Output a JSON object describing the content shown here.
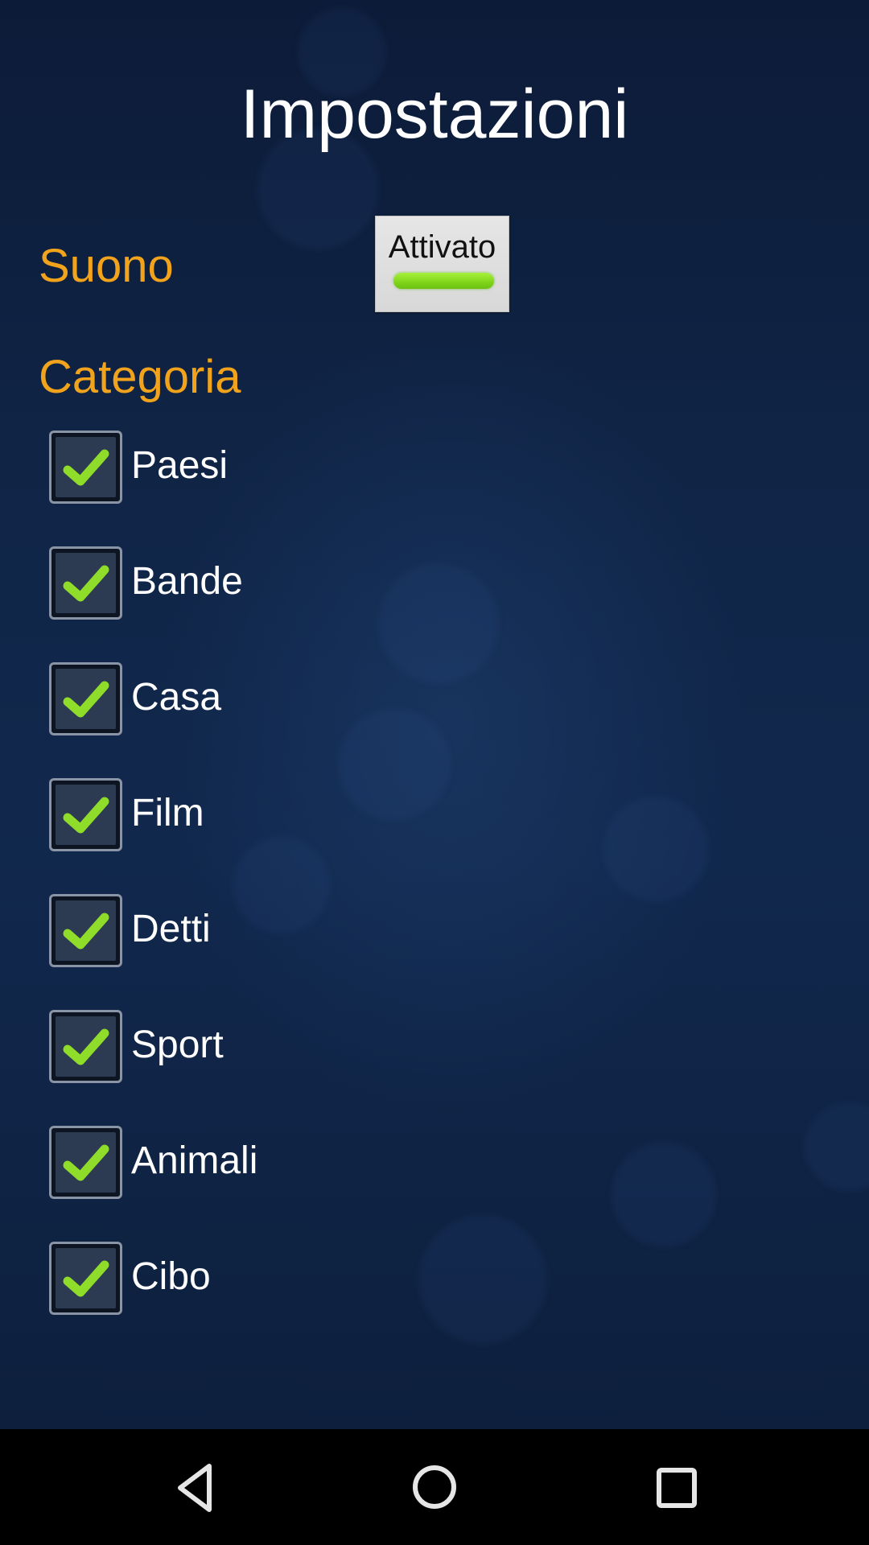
{
  "page": {
    "title": "Impostazioni"
  },
  "sound": {
    "label": "Suono",
    "toggle_label": "Attivato",
    "enabled": true
  },
  "category": {
    "label": "Categoria",
    "items": [
      {
        "label": "Paesi",
        "checked": true
      },
      {
        "label": "Bande",
        "checked": true
      },
      {
        "label": "Casa",
        "checked": true
      },
      {
        "label": "Film",
        "checked": true
      },
      {
        "label": "Detti",
        "checked": true
      },
      {
        "label": "Sport",
        "checked": true
      },
      {
        "label": "Animali",
        "checked": true
      },
      {
        "label": "Cibo",
        "checked": true
      }
    ]
  },
  "navbar": {
    "back_icon": "back-triangle-icon",
    "home_icon": "home-circle-icon",
    "recents_icon": "recents-square-icon"
  },
  "colors": {
    "accent_orange": "#f2a31c",
    "check_green": "#8fdc2a",
    "background_navy": "#102547"
  }
}
